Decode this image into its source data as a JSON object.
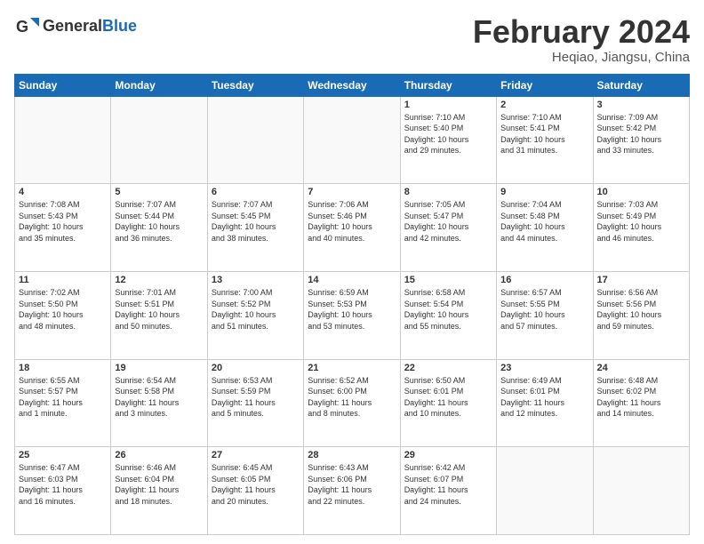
{
  "logo": {
    "text_general": "General",
    "text_blue": "Blue"
  },
  "header": {
    "title": "February 2024",
    "subtitle": "Heqiao, Jiangsu, China"
  },
  "weekdays": [
    "Sunday",
    "Monday",
    "Tuesday",
    "Wednesday",
    "Thursday",
    "Friday",
    "Saturday"
  ],
  "weeks": [
    [
      {
        "day": "",
        "info": ""
      },
      {
        "day": "",
        "info": ""
      },
      {
        "day": "",
        "info": ""
      },
      {
        "day": "",
        "info": ""
      },
      {
        "day": "1",
        "info": "Sunrise: 7:10 AM\nSunset: 5:40 PM\nDaylight: 10 hours\nand 29 minutes."
      },
      {
        "day": "2",
        "info": "Sunrise: 7:10 AM\nSunset: 5:41 PM\nDaylight: 10 hours\nand 31 minutes."
      },
      {
        "day": "3",
        "info": "Sunrise: 7:09 AM\nSunset: 5:42 PM\nDaylight: 10 hours\nand 33 minutes."
      }
    ],
    [
      {
        "day": "4",
        "info": "Sunrise: 7:08 AM\nSunset: 5:43 PM\nDaylight: 10 hours\nand 35 minutes."
      },
      {
        "day": "5",
        "info": "Sunrise: 7:07 AM\nSunset: 5:44 PM\nDaylight: 10 hours\nand 36 minutes."
      },
      {
        "day": "6",
        "info": "Sunrise: 7:07 AM\nSunset: 5:45 PM\nDaylight: 10 hours\nand 38 minutes."
      },
      {
        "day": "7",
        "info": "Sunrise: 7:06 AM\nSunset: 5:46 PM\nDaylight: 10 hours\nand 40 minutes."
      },
      {
        "day": "8",
        "info": "Sunrise: 7:05 AM\nSunset: 5:47 PM\nDaylight: 10 hours\nand 42 minutes."
      },
      {
        "day": "9",
        "info": "Sunrise: 7:04 AM\nSunset: 5:48 PM\nDaylight: 10 hours\nand 44 minutes."
      },
      {
        "day": "10",
        "info": "Sunrise: 7:03 AM\nSunset: 5:49 PM\nDaylight: 10 hours\nand 46 minutes."
      }
    ],
    [
      {
        "day": "11",
        "info": "Sunrise: 7:02 AM\nSunset: 5:50 PM\nDaylight: 10 hours\nand 48 minutes."
      },
      {
        "day": "12",
        "info": "Sunrise: 7:01 AM\nSunset: 5:51 PM\nDaylight: 10 hours\nand 50 minutes."
      },
      {
        "day": "13",
        "info": "Sunrise: 7:00 AM\nSunset: 5:52 PM\nDaylight: 10 hours\nand 51 minutes."
      },
      {
        "day": "14",
        "info": "Sunrise: 6:59 AM\nSunset: 5:53 PM\nDaylight: 10 hours\nand 53 minutes."
      },
      {
        "day": "15",
        "info": "Sunrise: 6:58 AM\nSunset: 5:54 PM\nDaylight: 10 hours\nand 55 minutes."
      },
      {
        "day": "16",
        "info": "Sunrise: 6:57 AM\nSunset: 5:55 PM\nDaylight: 10 hours\nand 57 minutes."
      },
      {
        "day": "17",
        "info": "Sunrise: 6:56 AM\nSunset: 5:56 PM\nDaylight: 10 hours\nand 59 minutes."
      }
    ],
    [
      {
        "day": "18",
        "info": "Sunrise: 6:55 AM\nSunset: 5:57 PM\nDaylight: 11 hours\nand 1 minute."
      },
      {
        "day": "19",
        "info": "Sunrise: 6:54 AM\nSunset: 5:58 PM\nDaylight: 11 hours\nand 3 minutes."
      },
      {
        "day": "20",
        "info": "Sunrise: 6:53 AM\nSunset: 5:59 PM\nDaylight: 11 hours\nand 5 minutes."
      },
      {
        "day": "21",
        "info": "Sunrise: 6:52 AM\nSunset: 6:00 PM\nDaylight: 11 hours\nand 8 minutes."
      },
      {
        "day": "22",
        "info": "Sunrise: 6:50 AM\nSunset: 6:01 PM\nDaylight: 11 hours\nand 10 minutes."
      },
      {
        "day": "23",
        "info": "Sunrise: 6:49 AM\nSunset: 6:01 PM\nDaylight: 11 hours\nand 12 minutes."
      },
      {
        "day": "24",
        "info": "Sunrise: 6:48 AM\nSunset: 6:02 PM\nDaylight: 11 hours\nand 14 minutes."
      }
    ],
    [
      {
        "day": "25",
        "info": "Sunrise: 6:47 AM\nSunset: 6:03 PM\nDaylight: 11 hours\nand 16 minutes."
      },
      {
        "day": "26",
        "info": "Sunrise: 6:46 AM\nSunset: 6:04 PM\nDaylight: 11 hours\nand 18 minutes."
      },
      {
        "day": "27",
        "info": "Sunrise: 6:45 AM\nSunset: 6:05 PM\nDaylight: 11 hours\nand 20 minutes."
      },
      {
        "day": "28",
        "info": "Sunrise: 6:43 AM\nSunset: 6:06 PM\nDaylight: 11 hours\nand 22 minutes."
      },
      {
        "day": "29",
        "info": "Sunrise: 6:42 AM\nSunset: 6:07 PM\nDaylight: 11 hours\nand 24 minutes."
      },
      {
        "day": "",
        "info": ""
      },
      {
        "day": "",
        "info": ""
      }
    ]
  ]
}
